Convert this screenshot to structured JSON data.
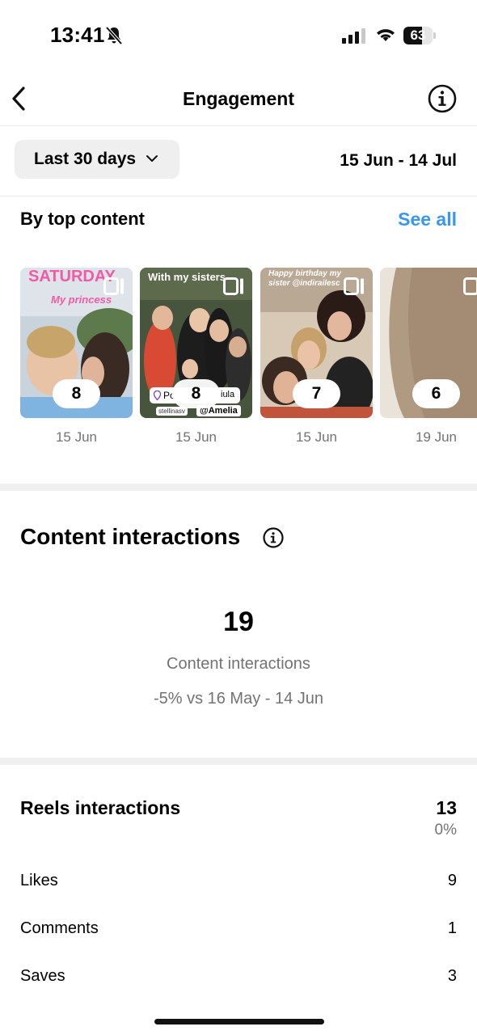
{
  "status_bar": {
    "time": "13:41",
    "battery": "63",
    "battery_fraction": 0.63
  },
  "header": {
    "title": "Engagement"
  },
  "filter": {
    "range_label": "Last 30 days",
    "date_range": "15 Jun - 14 Jul"
  },
  "top_content": {
    "heading": "By top content",
    "see_all": "See all",
    "items": [
      {
        "caption": "SATURDAY",
        "caption2": "My princess",
        "count": "8",
        "date": "15 Jun"
      },
      {
        "caption": "With my sisters",
        "tag1": "Pc",
        "tag1b": "iula",
        "tag2": "stellinasv",
        "tag3": "@Amelia",
        "count": "8",
        "date": "15 Jun"
      },
      {
        "caption": "Happy birthday my",
        "caption2": "sister @indirailesc",
        "count": "7",
        "date": "15 Jun"
      },
      {
        "count": "6",
        "date": "19 Jun"
      }
    ]
  },
  "content_interactions": {
    "title": "Content interactions",
    "value": "19",
    "label": "Content interactions",
    "comparison": "-5% vs 16 May - 14 Jun"
  },
  "reels_interactions": {
    "title": "Reels interactions",
    "total": "13",
    "change": "0%",
    "metrics": [
      {
        "label": "Likes",
        "value": "9"
      },
      {
        "label": "Comments",
        "value": "1"
      },
      {
        "label": "Saves",
        "value": "3"
      }
    ]
  }
}
